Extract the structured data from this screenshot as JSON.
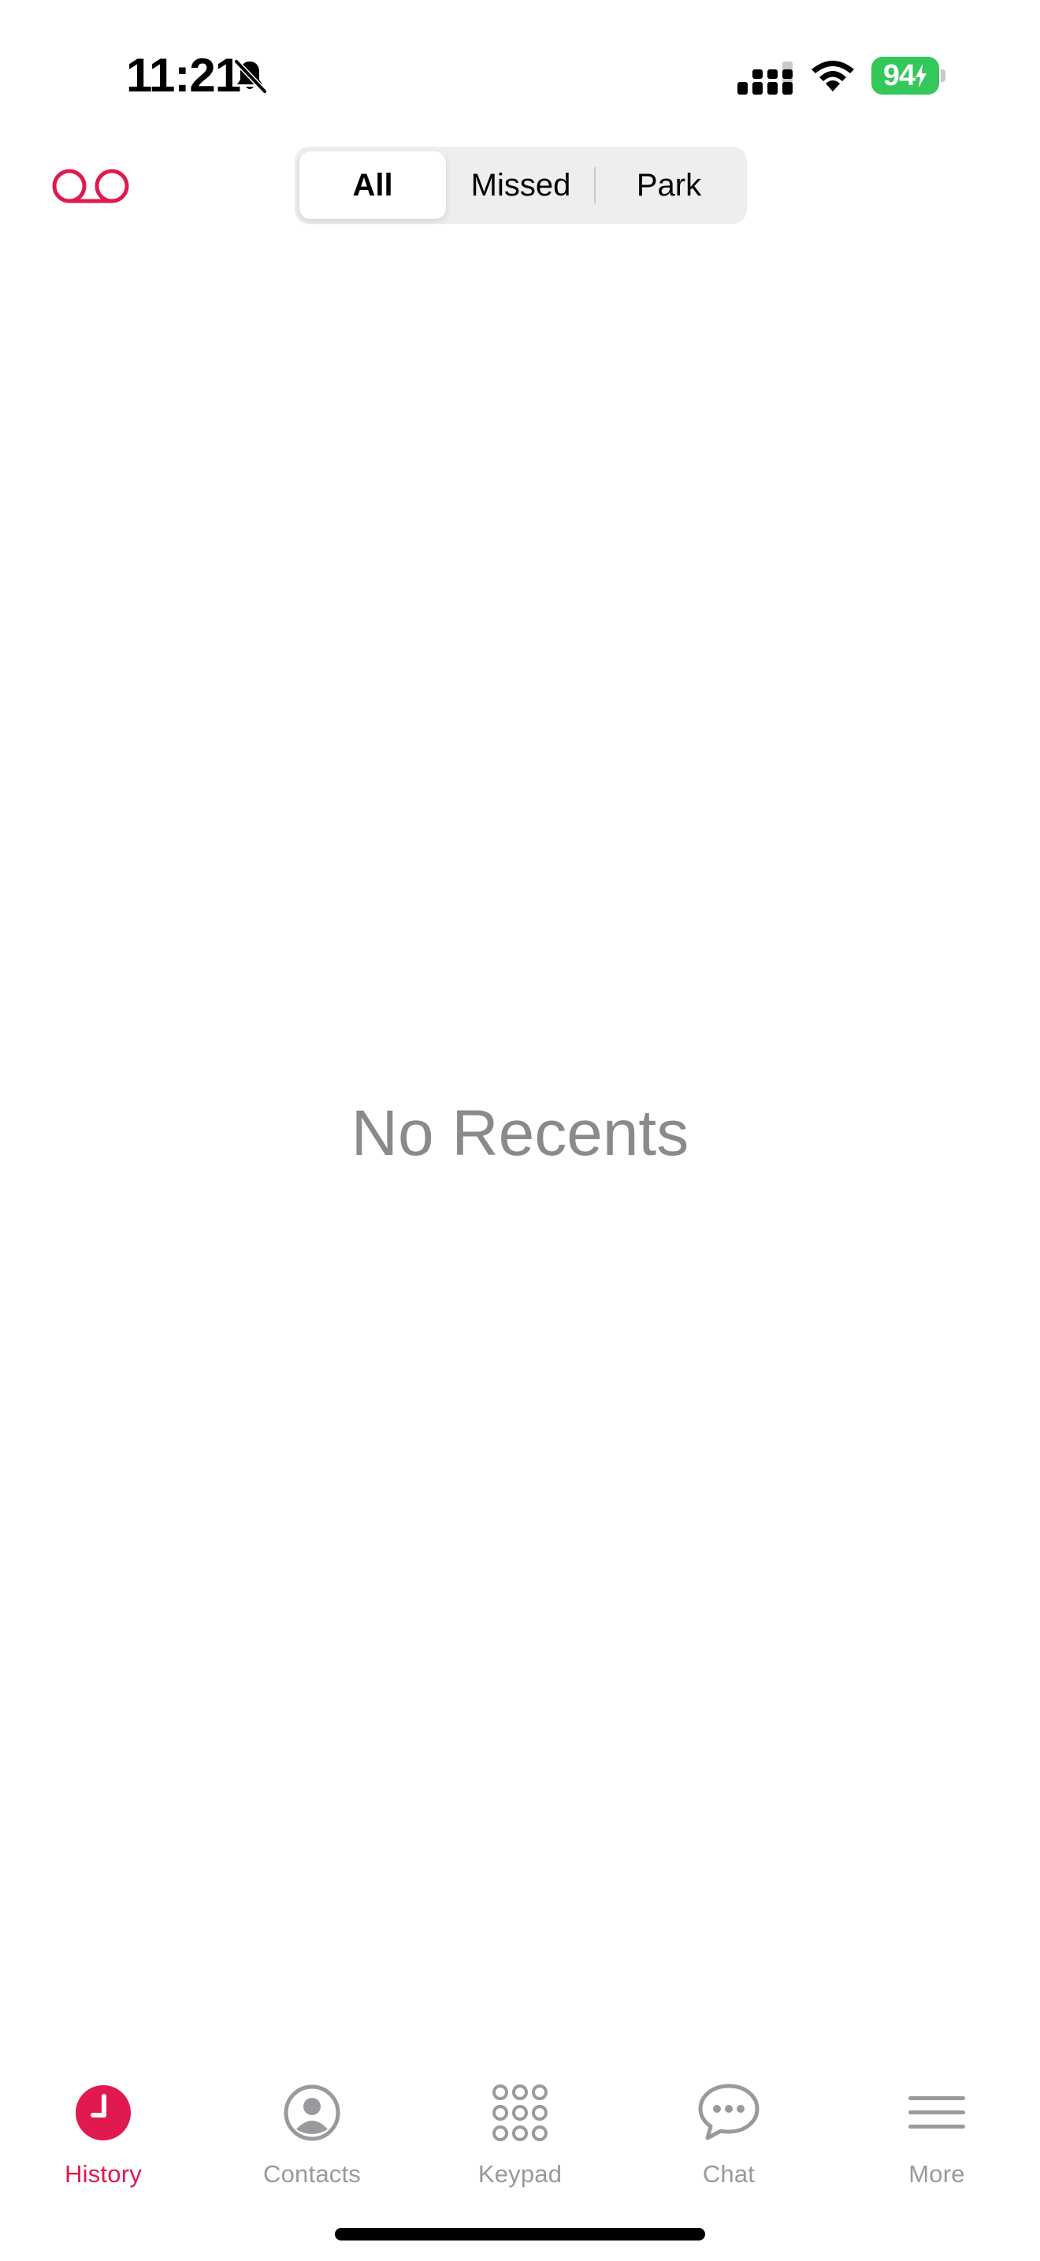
{
  "status_bar": {
    "time": "11:21",
    "battery_percent": "94",
    "icons": [
      "bell-slash-icon",
      "cellular-signal-icon",
      "wifi-icon",
      "battery-charging-icon"
    ]
  },
  "header": {
    "voicemail_icon": "voicemail-icon",
    "segments": [
      {
        "label": "All",
        "selected": true
      },
      {
        "label": "Missed",
        "selected": false
      },
      {
        "label": "Park",
        "selected": false
      }
    ]
  },
  "main": {
    "empty_text": "No Recents"
  },
  "tab_bar": {
    "items": [
      {
        "label": "History",
        "icon": "clock-icon",
        "active": true
      },
      {
        "label": "Contacts",
        "icon": "person-circle-icon",
        "active": false
      },
      {
        "label": "Keypad",
        "icon": "keypad-icon",
        "active": false
      },
      {
        "label": "Chat",
        "icon": "chat-bubble-icon",
        "active": false
      },
      {
        "label": "More",
        "icon": "menu-lines-icon",
        "active": false
      }
    ]
  },
  "colors": {
    "accent": "#e0194f",
    "battery": "#34c759",
    "inactive": "#9a9a9e",
    "empty_text": "#8a8a8e",
    "segment_bg": "#eeeeef"
  }
}
